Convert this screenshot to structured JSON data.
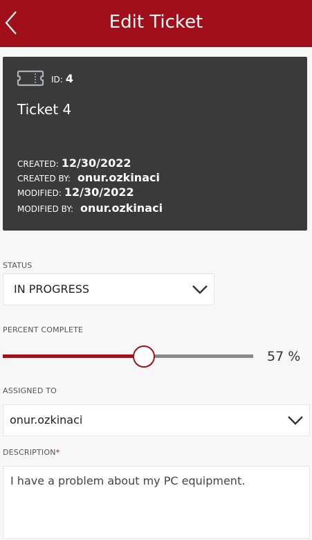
{
  "header": {
    "title": "Edit Ticket",
    "back_icon": "chevron-left-icon"
  },
  "ticket_card": {
    "icon": "ticket-icon",
    "id_label": "ID:",
    "id_value": "4",
    "title": "Ticket 4",
    "created_label": "CREATED:",
    "created_value": "12/30/2022",
    "created_by_label": "CREATED BY:",
    "created_by_value": "onur.ozkinaci",
    "modified_label": "MODIFIED:",
    "modified_value": "12/30/2022",
    "modified_by_label": "MODIFIED BY:",
    "modified_by_value": "onur.ozkinaci"
  },
  "status": {
    "label": "STATUS",
    "value": "IN PROGRESS"
  },
  "percent_complete": {
    "label": "PERCENT COMPLETE",
    "value": 57,
    "display": "57 %"
  },
  "assigned_to": {
    "label": "ASSIGNED TO",
    "value": "onur.ozkinaci"
  },
  "description": {
    "label": "DESCRIPTION",
    "required_marker": "*",
    "value": "I have a problem about my PC equipment."
  },
  "colors": {
    "accent": "#a1101a",
    "card_bg": "#3a3a3a",
    "page_bg": "#f7f7f7"
  }
}
